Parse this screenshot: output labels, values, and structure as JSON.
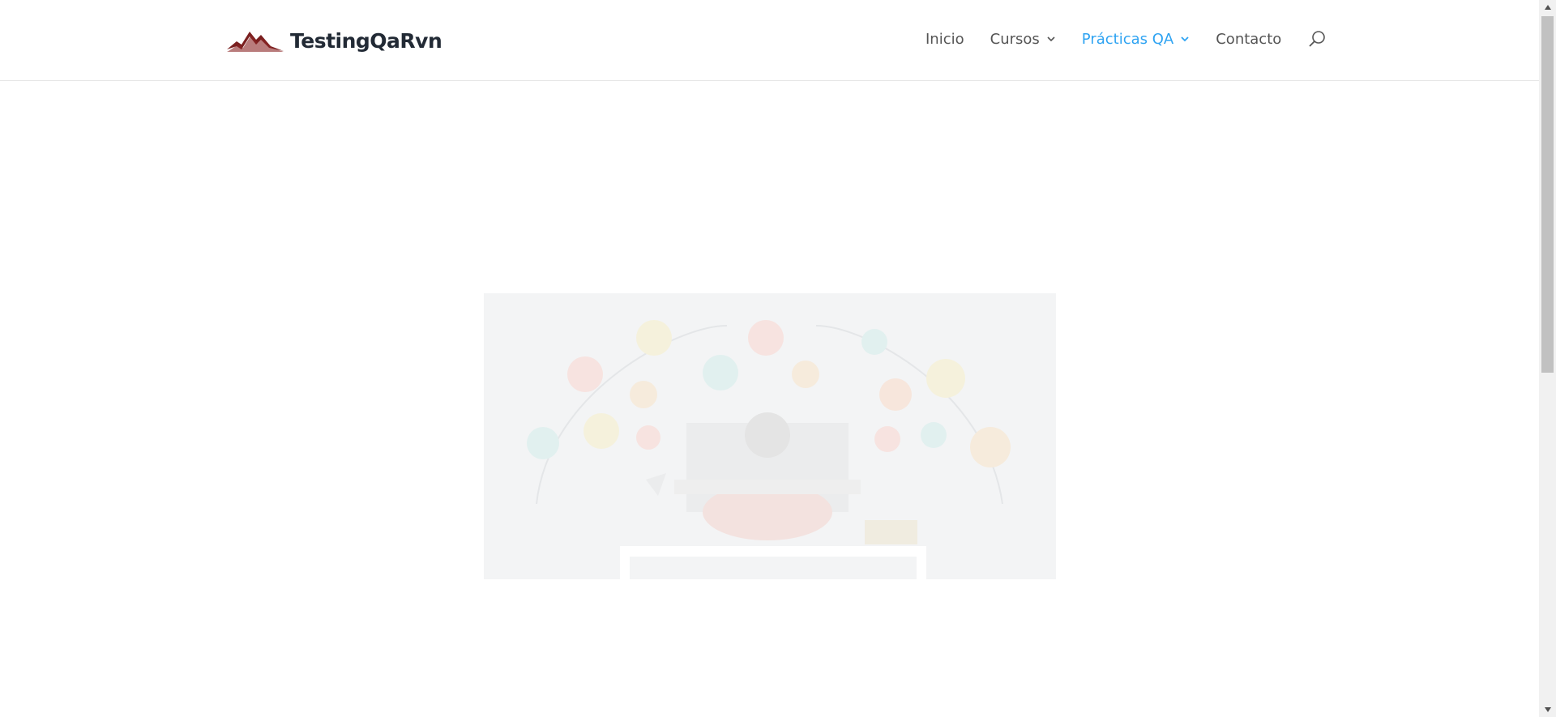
{
  "brand": {
    "name": "TestingQaRvn"
  },
  "nav": {
    "items": [
      {
        "label": "Inicio",
        "has_dropdown": false,
        "active": false
      },
      {
        "label": "Cursos",
        "has_dropdown": true,
        "active": false
      },
      {
        "label": "Prácticas QA",
        "has_dropdown": true,
        "active": true
      },
      {
        "label": "Contacto",
        "has_dropdown": false,
        "active": false
      }
    ],
    "search_icon": "search-icon"
  },
  "colors": {
    "accent": "#2ea3f2",
    "nav_text": "#555555",
    "logo_mountain": "#7a1f1f",
    "hero_bg": "#f3f4f5"
  },
  "hero": {
    "image": "programming-illustration"
  }
}
